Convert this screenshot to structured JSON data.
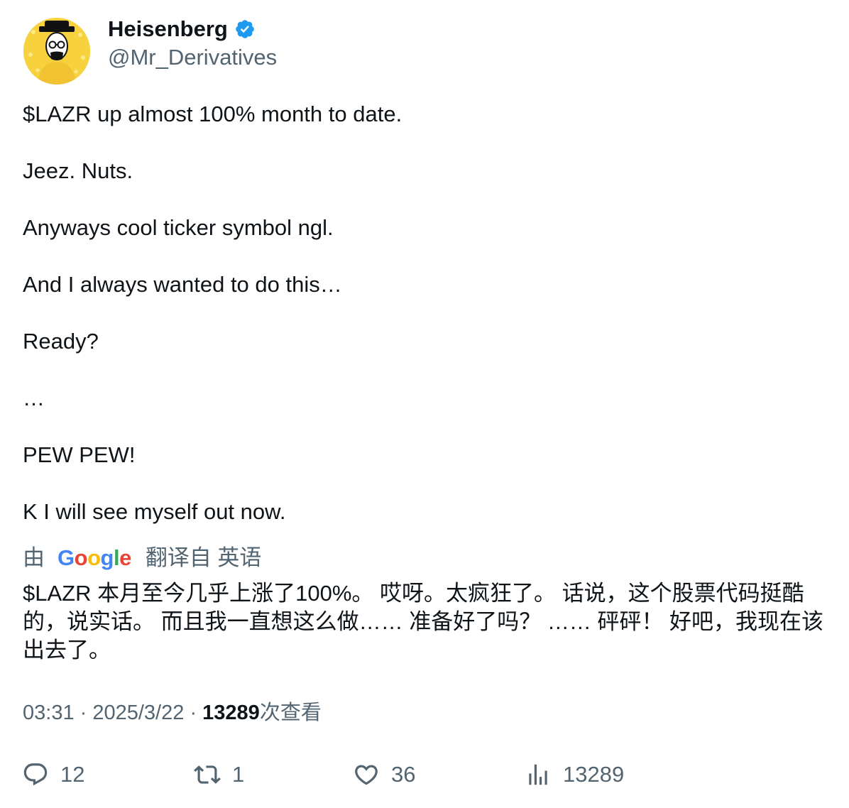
{
  "author": {
    "display_name": "Heisenberg",
    "handle": "@Mr_Derivatives",
    "verified_icon": "verified-badge-icon",
    "avatar_icon": "heisenberg-avatar-icon"
  },
  "tweet": {
    "lines": [
      "$LAZR up almost 100% month to date.",
      "Jeez. Nuts.",
      "Anyways cool ticker symbol ngl.",
      "And I always wanted to do this…",
      "Ready?",
      "…",
      "PEW PEW!",
      "K I will see myself out now."
    ]
  },
  "translation": {
    "prefix": "由",
    "provider": "Google",
    "suffix": "翻译自 英语",
    "text": "$LAZR 本月至今几乎上涨了100%。 哎呀。太疯狂了。 话说，这个股票代码挺酷的，说实话。 而且我一直想这么做…… 准备好了吗？ …… 砰砰！ 好吧，我现在该出去了。"
  },
  "meta": {
    "time": "03:31",
    "separator": "·",
    "date": "2025/3/22",
    "views_count": "13289",
    "views_label": "次查看"
  },
  "actions": {
    "reply": {
      "icon": "reply-icon",
      "count": "12"
    },
    "retweet": {
      "icon": "retweet-icon",
      "count": "1"
    },
    "like": {
      "icon": "heart-icon",
      "count": "36"
    },
    "views": {
      "icon": "analytics-icon",
      "count": "13289"
    }
  },
  "colors": {
    "text": "#0f1419",
    "secondary": "#536471",
    "verified_blue": "#1d9bf0",
    "avatar_yellow": "#f7d23e"
  }
}
